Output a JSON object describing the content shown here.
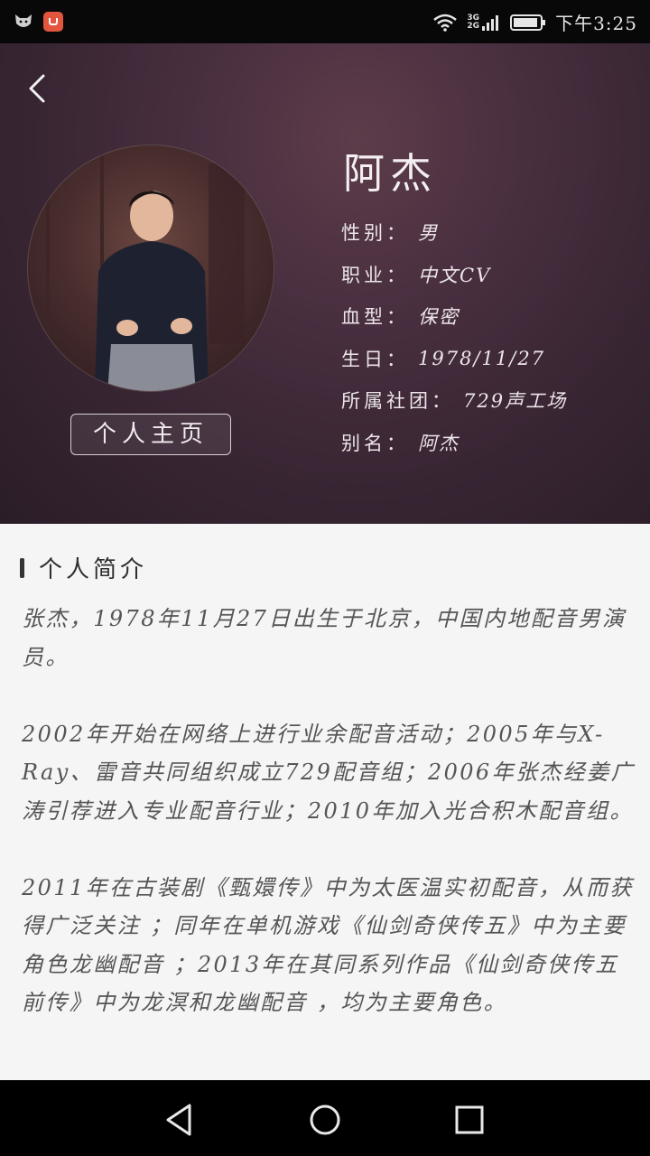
{
  "status_bar": {
    "network": "3G\n2G",
    "time": "下午3:25"
  },
  "header": {
    "name": "阿杰",
    "profile_button": "个人主页",
    "info": [
      {
        "label": "性别：",
        "value": "男"
      },
      {
        "label": "职业：",
        "value": "中文CV"
      },
      {
        "label": "血型：",
        "value": "保密"
      },
      {
        "label": "生日：",
        "value": "1978/11/27"
      },
      {
        "label": "所属社团：",
        "value": "729声工场"
      },
      {
        "label": "别名：",
        "value": "阿杰"
      }
    ]
  },
  "intro": {
    "title": "个人简介",
    "paragraphs": [
      "张杰，1978年11月27日出生于北京，中国内地配音男演员。",
      "2002年开始在网络上进行业余配音活动；2005年与X-Ray、雷音共同组织成立729配音组；2006年张杰经姜广涛引荐进入专业配音行业；2010年加入光合积木配音组。",
      "2011年在古装剧《甄嬛传》中为太医温实初配音，从而获得广泛关注 ；同年在单机游戏《仙剑奇侠传五》中为主要角色龙幽配音 ；2013年在其同系列作品《仙剑奇侠传五前传》中为龙溟和龙幽配音 ，均为主要角色。"
    ]
  },
  "icons": {
    "back": "back-icon",
    "nav_back": "nav-back-icon",
    "nav_home": "nav-home-icon",
    "nav_recents": "nav-recents-icon"
  }
}
